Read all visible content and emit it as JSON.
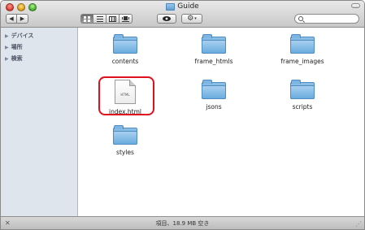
{
  "window": {
    "title": "Guide"
  },
  "toolbar": {
    "nav": [
      "◀",
      "▶"
    ],
    "view_modes": [
      "icon-view",
      "list-view",
      "column-view",
      "coverflow-view"
    ],
    "quicklook_icon": "eye-icon",
    "action_icon": "gear-icon",
    "search": {
      "value": "",
      "placeholder": ""
    }
  },
  "sidebar": {
    "items": [
      {
        "label": "デバイス"
      },
      {
        "label": "場所"
      },
      {
        "label": "検索"
      }
    ]
  },
  "content": {
    "items": [
      {
        "label": "contents",
        "kind": "folder"
      },
      {
        "label": "frame_htmls",
        "kind": "folder"
      },
      {
        "label": "frame_images",
        "kind": "folder"
      },
      {
        "label": "index.html",
        "kind": "html-file",
        "type_text": "HTML",
        "selected": true
      },
      {
        "label": "jsons",
        "kind": "folder"
      },
      {
        "label": "scripts",
        "kind": "folder"
      },
      {
        "label": "styles",
        "kind": "folder"
      }
    ]
  },
  "status": {
    "text": "項目、18.9 MB 空き"
  },
  "colors": {
    "sidebar_bg": "#dfe5ed",
    "highlight": "#e0111d",
    "folder_blue": "#69acde"
  }
}
